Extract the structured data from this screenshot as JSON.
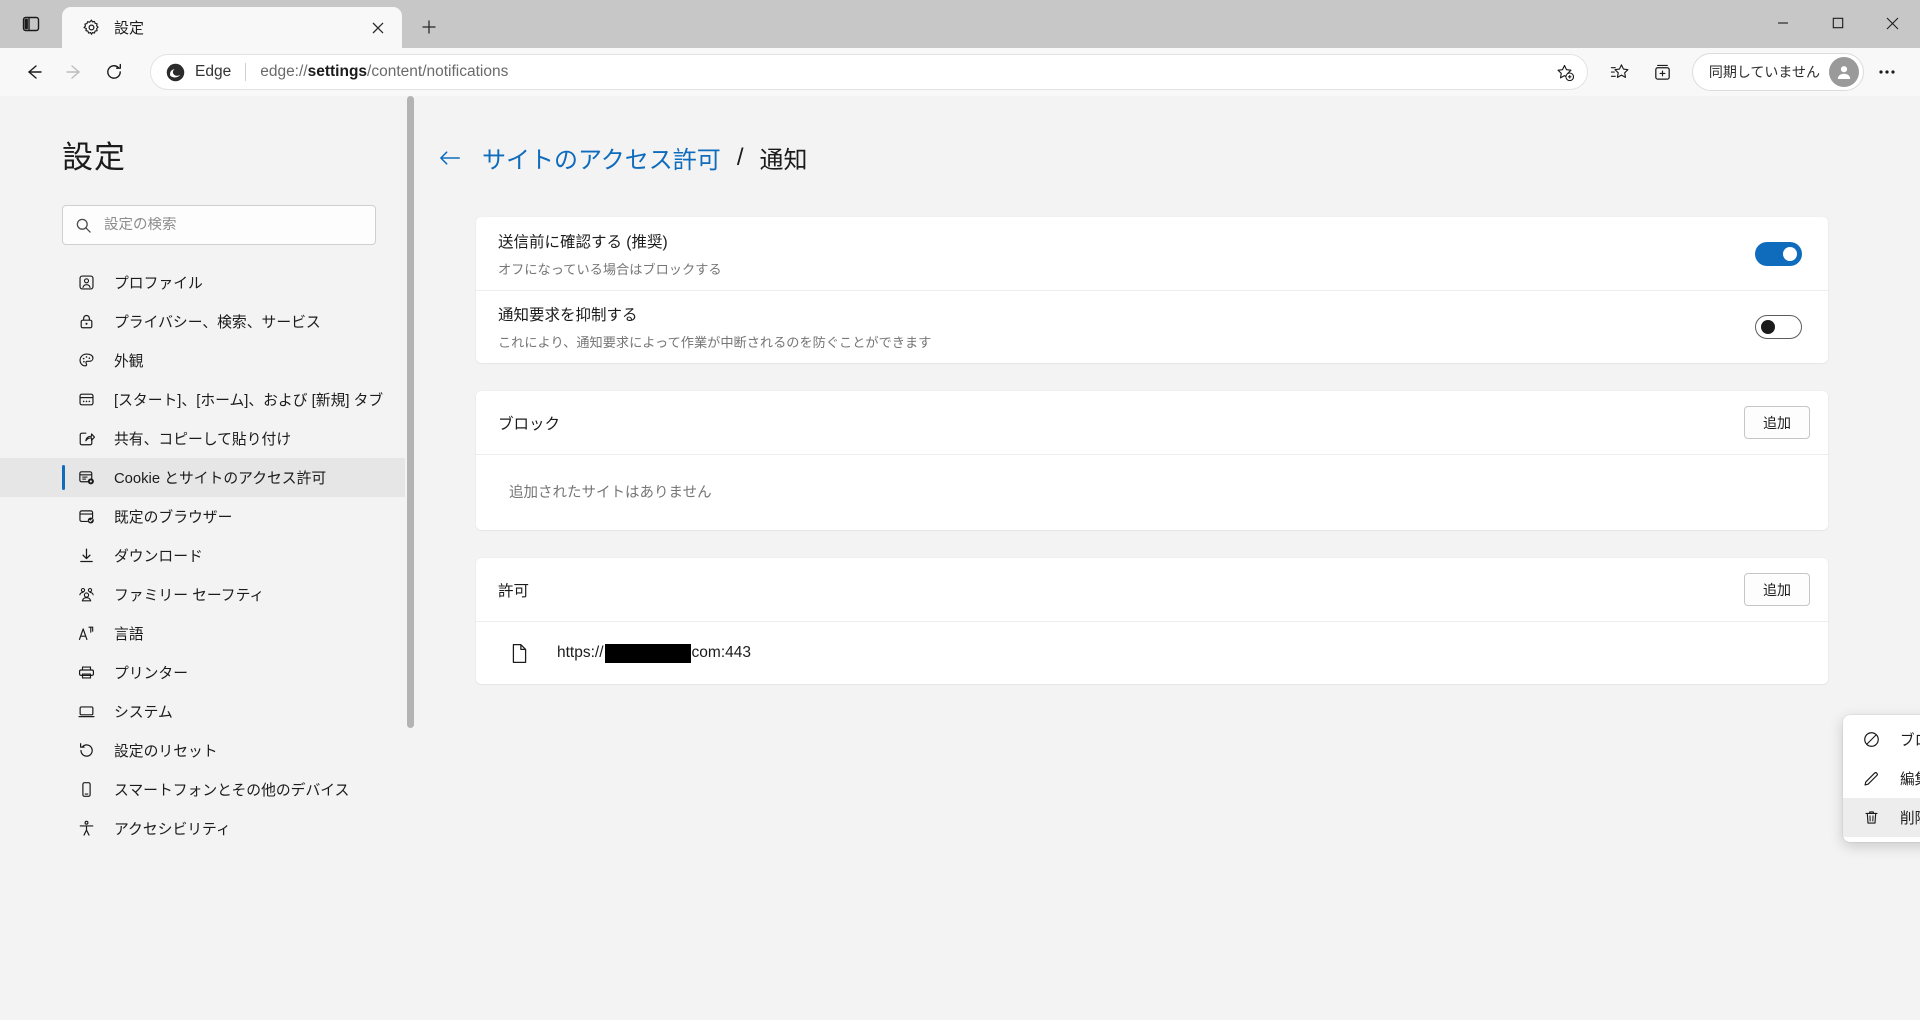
{
  "window": {
    "titlebar": {
      "tab_search_icon": "tab-search-icon",
      "tab": {
        "favicon": "gear-icon",
        "title": "設定",
        "close_icon": "close-icon"
      },
      "new_tab_icon": "plus-icon",
      "controls": {
        "minimize": "minimize-icon",
        "maximize": "maximize-icon",
        "close": "close-icon"
      }
    },
    "toolbar": {
      "back_icon": "arrow-left-icon",
      "forward_icon": "arrow-right-icon",
      "refresh_icon": "refresh-icon",
      "omnibox": {
        "brand_icon": "edge-logo-icon",
        "brand_label": "Edge",
        "url_prefix": "edge://",
        "url_bold": "settings",
        "url_suffix": "/content/notifications",
        "favorite_icon": "star-add-icon"
      },
      "favorites_icon": "favorites-icon",
      "collections_icon": "collections-icon",
      "profile_label": "同期していません",
      "avatar_icon": "person-icon",
      "settings_more_icon": "ellipsis-icon"
    }
  },
  "sidebar": {
    "heading": "設定",
    "search": {
      "placeholder": "設定の検索",
      "value": "",
      "icon": "search-icon"
    },
    "items": [
      {
        "label": "プロファイル",
        "icon": "profile-icon",
        "active": false
      },
      {
        "label": "プライバシー、検索、サービス",
        "icon": "lock-icon",
        "active": false
      },
      {
        "label": "外観",
        "icon": "palette-icon",
        "active": false
      },
      {
        "label": "[スタート]、[ホーム]、および [新規] タブ",
        "icon": "window-icon",
        "active": false
      },
      {
        "label": "共有、コピーして貼り付け",
        "icon": "share-icon",
        "active": false
      },
      {
        "label": "Cookie とサイトのアクセス許可",
        "icon": "cookie-settings-icon",
        "active": true
      },
      {
        "label": "既定のブラウザー",
        "icon": "default-browser-icon",
        "active": false
      },
      {
        "label": "ダウンロード",
        "icon": "download-icon",
        "active": false
      },
      {
        "label": "ファミリー セーフティ",
        "icon": "family-icon",
        "active": false
      },
      {
        "label": "言語",
        "icon": "language-icon",
        "active": false
      },
      {
        "label": "プリンター",
        "icon": "printer-icon",
        "active": false
      },
      {
        "label": "システム",
        "icon": "system-icon",
        "active": false
      },
      {
        "label": "設定のリセット",
        "icon": "reset-icon",
        "active": false
      },
      {
        "label": "スマートフォンとその他のデバイス",
        "icon": "phone-icon",
        "active": false
      },
      {
        "label": "アクセシビリティ",
        "icon": "accessibility-icon",
        "active": false
      }
    ]
  },
  "main": {
    "breadcrumb": {
      "back_icon": "arrow-left-icon",
      "parent": "サイトのアクセス許可",
      "separator": "/",
      "current": "通知"
    },
    "settings": [
      {
        "title": "送信前に確認する (推奨)",
        "description": "オフになっている場合はブロックする",
        "toggle_state": "on"
      },
      {
        "title": "通知要求を抑制する",
        "description": "これにより、通知要求によって作業が中断されるのを防ぐことができます",
        "toggle_state": "off"
      }
    ],
    "block_section": {
      "title": "ブロック",
      "add_label": "追加",
      "empty_text": "追加されたサイトはありません",
      "sites": []
    },
    "allow_section": {
      "title": "許可",
      "add_label": "追加",
      "sites": [
        {
          "icon": "document-icon",
          "url_prefix": "https://",
          "url_redacted": true,
          "url_suffix": "com:443"
        }
      ]
    }
  },
  "context_menu": {
    "items": [
      {
        "label": "ブロック",
        "icon": "block-icon",
        "highlighted": false
      },
      {
        "label": "編集",
        "icon": "pencil-icon",
        "highlighted": false
      },
      {
        "label": "削除",
        "icon": "trash-icon",
        "highlighted": true
      }
    ]
  },
  "colors": {
    "accent": "#0f6cbd",
    "titlebar_bg": "#c7c7c7",
    "toolbar_bg": "#f8f8f8",
    "page_bg": "#f3f3f3",
    "card_bg": "#ffffff"
  }
}
